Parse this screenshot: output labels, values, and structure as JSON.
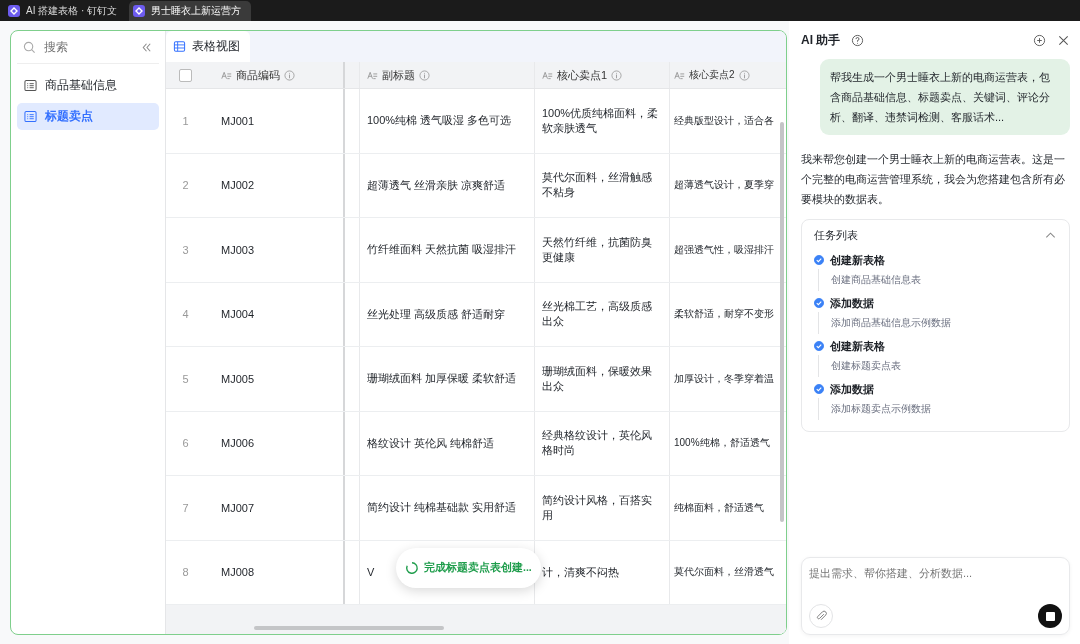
{
  "browser_tabs": [
    {
      "label": "AI 搭建表格 · 钉钉文",
      "selected": false
    },
    {
      "label": "男士睡衣上新运营方",
      "selected": true
    }
  ],
  "sidebar": {
    "search_placeholder": "搜索",
    "items": [
      {
        "label": "商品基础信息",
        "selected": false
      },
      {
        "label": "标题卖点",
        "selected": true
      }
    ]
  },
  "view_tabs": [
    {
      "label": "表格视图",
      "selected": true
    }
  ],
  "table": {
    "header_checkbox": {
      "checked": false
    },
    "columns": [
      "商品编码",
      "副标题",
      "核心卖点1",
      "核心卖点2"
    ],
    "rows": [
      {
        "number": "1",
        "cells": [
          "MJ001",
          "100%纯棉 透气吸湿 多色可选",
          "100%优质纯棉面料，柔软亲肤透气",
          "经典版型设计，适合各"
        ]
      },
      {
        "number": "2",
        "cells": [
          "MJ002",
          "超薄透气 丝滑亲肤 凉爽舒适",
          "莫代尔面料，丝滑触感不粘身",
          "超薄透气设计，夏季穿"
        ]
      },
      {
        "number": "3",
        "cells": [
          "MJ003",
          "竹纤维面料 天然抗菌 吸湿排汗",
          "天然竹纤维，抗菌防臭更健康",
          "超强透气性，吸湿排汗"
        ]
      },
      {
        "number": "4",
        "cells": [
          "MJ004",
          "丝光处理 高级质感 舒适耐穿",
          "丝光棉工艺，高级质感出众",
          "柔软舒适，耐穿不变形"
        ]
      },
      {
        "number": "5",
        "cells": [
          "MJ005",
          "珊瑚绒面料 加厚保暖 柔软舒适",
          "珊瑚绒面料，保暖效果出众",
          "加厚设计，冬季穿着温"
        ]
      },
      {
        "number": "6",
        "cells": [
          "MJ006",
          "格纹设计 英伦风 纯棉舒适",
          "经典格纹设计，英伦风格时尚",
          "100%纯棉，舒适透气"
        ]
      },
      {
        "number": "7",
        "cells": [
          "MJ007",
          "简约设计 纯棉基础款 实用舒适",
          "简约设计风格，百搭实用",
          "纯棉面料，舒适透气"
        ]
      },
      {
        "number": "8",
        "cells": [
          "MJ008",
          "V",
          "计，清爽不闷热",
          "莫代尔面料，丝滑透气"
        ]
      }
    ]
  },
  "toast": {
    "text": "完成标题卖点表创建..."
  },
  "assistant": {
    "title": "AI 助手",
    "user_message": "帮我生成一个男士睡衣上新的电商运营表，包含商品基础信息、标题卖点、关键词、评论分析、翻译、违禁词检测、客服话术...",
    "reply": "我来帮您创建一个男士睡衣上新的电商运营表。这是一个完整的电商运营管理系统，我会为您搭建包含所有必要模块的数据表。",
    "task_list": {
      "title": "任务列表",
      "expanded": true,
      "tasks": [
        {
          "title": "创建新表格",
          "detail": "创建商品基础信息表",
          "done": true
        },
        {
          "title": "添加数据",
          "detail": "添加商品基础信息示例数据",
          "done": true
        },
        {
          "title": "创建新表格",
          "detail": "创建标题卖点表",
          "done": true
        },
        {
          "title": "添加数据",
          "detail": "添加标题卖点示例数据",
          "done": true
        }
      ]
    },
    "input": {
      "placeholder": "提出需求、帮你搭建、分析数据..."
    }
  }
}
